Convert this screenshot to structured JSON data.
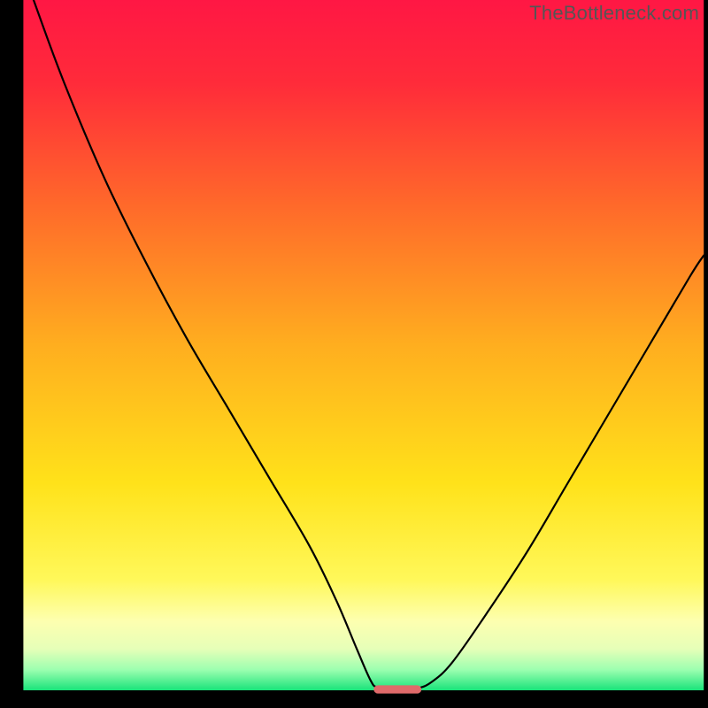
{
  "watermark": "TheBottleneck.com",
  "chart_data": {
    "type": "line",
    "title": "",
    "xlabel": "",
    "ylabel": "",
    "xlim": [
      0,
      100
    ],
    "ylim": [
      0,
      100
    ],
    "background": {
      "type": "vertical-gradient",
      "stops": [
        {
          "offset": 0.0,
          "color": "#ff1744"
        },
        {
          "offset": 0.12,
          "color": "#ff2b3a"
        },
        {
          "offset": 0.3,
          "color": "#ff6a2a"
        },
        {
          "offset": 0.5,
          "color": "#ffae1f"
        },
        {
          "offset": 0.7,
          "color": "#ffe21a"
        },
        {
          "offset": 0.84,
          "color": "#fff85a"
        },
        {
          "offset": 0.9,
          "color": "#fdffb0"
        },
        {
          "offset": 0.94,
          "color": "#e6ffb8"
        },
        {
          "offset": 0.97,
          "color": "#9dffb0"
        },
        {
          "offset": 1.0,
          "color": "#19e37a"
        }
      ]
    },
    "series": [
      {
        "name": "bottleneck-curve",
        "color": "#000000",
        "points": [
          {
            "x": 1.5,
            "y": 100.0
          },
          {
            "x": 6.0,
            "y": 88.0
          },
          {
            "x": 12.0,
            "y": 74.0
          },
          {
            "x": 18.0,
            "y": 62.0
          },
          {
            "x": 24.0,
            "y": 51.0
          },
          {
            "x": 30.0,
            "y": 41.0
          },
          {
            "x": 36.0,
            "y": 31.0
          },
          {
            "x": 42.0,
            "y": 21.0
          },
          {
            "x": 46.0,
            "y": 13.0
          },
          {
            "x": 49.0,
            "y": 6.0
          },
          {
            "x": 51.0,
            "y": 1.5
          },
          {
            "x": 52.0,
            "y": 0.4
          },
          {
            "x": 54.0,
            "y": 0.0
          },
          {
            "x": 56.0,
            "y": 0.0
          },
          {
            "x": 58.0,
            "y": 0.3
          },
          {
            "x": 60.0,
            "y": 1.2
          },
          {
            "x": 63.0,
            "y": 4.0
          },
          {
            "x": 68.0,
            "y": 11.0
          },
          {
            "x": 74.0,
            "y": 20.0
          },
          {
            "x": 80.0,
            "y": 30.0
          },
          {
            "x": 86.0,
            "y": 40.0
          },
          {
            "x": 92.0,
            "y": 50.0
          },
          {
            "x": 98.0,
            "y": 60.0
          },
          {
            "x": 100.0,
            "y": 63.0
          }
        ]
      }
    ],
    "markers": [
      {
        "name": "optimal-marker",
        "shape": "rounded-bar",
        "x": 55,
        "y": 0,
        "width_pct": 7,
        "height_pct": 1.2,
        "color": "#e06a6a"
      }
    ],
    "frame": {
      "left_pct": 3.3,
      "right_pct": 0.6,
      "top_pct": 0.0,
      "bottom_pct": 2.5
    }
  }
}
